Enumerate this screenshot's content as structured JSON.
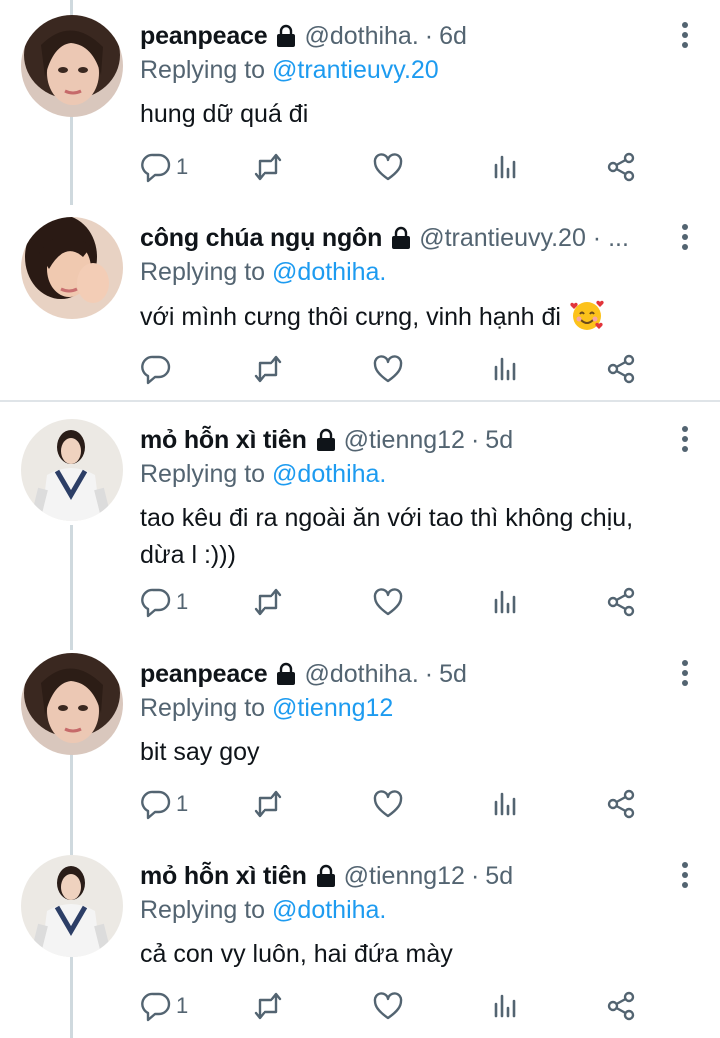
{
  "tweets": [
    {
      "name": "peanpeace",
      "handle": "@dothiha.",
      "time": "6d",
      "replying_prefix": "Replying to",
      "replying_to": "@trantieuvy.20",
      "text": "hung dữ quá đi",
      "reply_count": "1",
      "avatar": "woman-portrait-1"
    },
    {
      "name": "công chúa ngụ ngôn",
      "handle": "@trantieuvy.20 · ...",
      "time": "",
      "replying_prefix": "Replying to",
      "replying_to": "@dothiha.",
      "text": "với mình cưng thôi cưng, vinh hạnh đi",
      "emoji": "smiling-face-with-hearts",
      "reply_count": "",
      "avatar": "woman-portrait-2"
    },
    {
      "name": "mỏ hỗn xì tiên",
      "handle": "@tienng12",
      "time": "5d",
      "replying_prefix": "Replying to",
      "replying_to": "@dothiha.",
      "text": "tao kêu đi ra ngoài ăn với tao thì không chịu, dừa l :)))",
      "reply_count": "1",
      "avatar": "girl-school-vest"
    },
    {
      "name": "peanpeace",
      "handle": "@dothiha.",
      "time": "5d",
      "replying_prefix": "Replying to",
      "replying_to": "@tienng12",
      "text": "bit say goy",
      "reply_count": "1",
      "avatar": "woman-portrait-1"
    },
    {
      "name": "mỏ hỗn xì tiên",
      "handle": "@tienng12",
      "time": "5d",
      "replying_prefix": "Replying to",
      "replying_to": "@dothiha.",
      "text": "cả con vy luôn, hai đứa mày",
      "reply_count": "1",
      "avatar": "girl-school-vest"
    }
  ],
  "separator": "·",
  "icons": [
    "reply-icon",
    "retweet-icon",
    "like-icon",
    "analytics-icon",
    "share-icon",
    "lock-icon",
    "more-icon"
  ],
  "colors": {
    "mention": "#1d9bf0",
    "secondary": "#536471",
    "text": "#0f1419"
  }
}
